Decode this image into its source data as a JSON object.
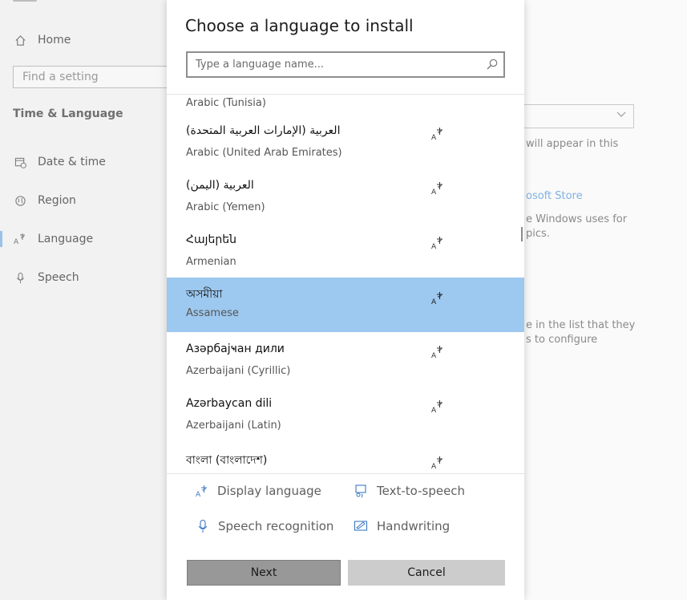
{
  "sidebar": {
    "home_label": "Home",
    "search_placeholder": "Find a setting",
    "section_title": "Time & Language",
    "items": [
      {
        "label": "Date & time",
        "icon": "calendar-clock-icon"
      },
      {
        "label": "Region",
        "icon": "globe-icon"
      },
      {
        "label": "Language",
        "icon": "language-icon"
      },
      {
        "label": "Speech",
        "icon": "microphone-icon"
      }
    ],
    "active_item": "Language"
  },
  "background": {
    "text1": "will appear in this",
    "link": "osoft Store",
    "text2a": "e Windows uses for",
    "text2b": "pics.",
    "text3a": "e in the list that they",
    "text3b": "s to configure"
  },
  "dialog": {
    "title": "Choose a language to install",
    "search_placeholder": "Type a language name...",
    "languages": [
      {
        "native": "",
        "english": "Arabic (Tunisia)"
      },
      {
        "native": "العربية (الإمارات العربية المتحدة)",
        "english": "Arabic (United Arab Emirates)"
      },
      {
        "native": "العربية (اليمن)",
        "english": "Arabic (Yemen)"
      },
      {
        "native": "Հայերեն",
        "english": "Armenian"
      },
      {
        "native": "অসমীয়া",
        "english": "Assamese",
        "selected": true
      },
      {
        "native": "Азәрбајҹан дили",
        "english": "Azerbaijani (Cyrillic)"
      },
      {
        "native": "Azərbaycan dili",
        "english": "Azerbaijani (Latin)"
      },
      {
        "native": "বাংলা (বাংলাদেশ)",
        "english": ""
      }
    ],
    "features": {
      "display_language": "Display language",
      "text_to_speech": "Text-to-speech",
      "speech_recognition": "Speech recognition",
      "handwriting": "Handwriting"
    },
    "next_label": "Next",
    "cancel_label": "Cancel"
  },
  "colors": {
    "selected_row": "#9dc8ef",
    "accent_icon": "#3a78c3",
    "next_button": "#989898",
    "cancel_button": "#cccccc"
  }
}
